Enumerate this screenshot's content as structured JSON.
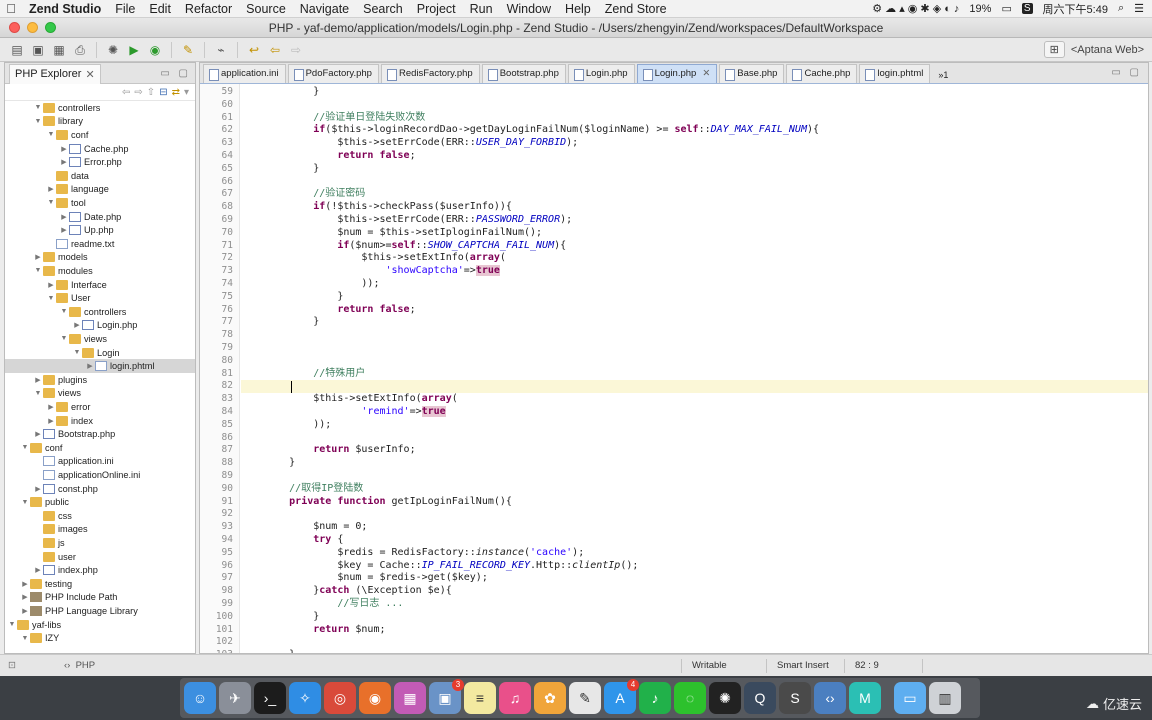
{
  "menubar": {
    "apple": "",
    "app_name": "Zend Studio",
    "items": [
      "File",
      "Edit",
      "Refactor",
      "Source",
      "Navigate",
      "Search",
      "Project",
      "Run",
      "Window",
      "Help",
      "Zend Store"
    ],
    "battery": "19%",
    "clock": "周六下午5:49"
  },
  "window": {
    "title": "PHP - yaf-demo/application/models/Login.php - Zend Studio - /Users/zhengyin/Zend/workspaces/DefaultWorkspace"
  },
  "toolbar": {
    "perspective_label": "<Aptana Web>"
  },
  "explorer": {
    "title": "PHP Explorer",
    "tree": [
      {
        "depth": 3,
        "exp": "open",
        "type": "folder",
        "label": "controllers"
      },
      {
        "depth": 3,
        "exp": "open",
        "type": "folder",
        "label": "library"
      },
      {
        "depth": 4,
        "exp": "open",
        "type": "folder",
        "label": "conf"
      },
      {
        "depth": 5,
        "exp": "closed",
        "type": "php",
        "label": "Cache.php"
      },
      {
        "depth": 5,
        "exp": "closed",
        "type": "php",
        "label": "Error.php"
      },
      {
        "depth": 4,
        "exp": "none",
        "type": "folder",
        "label": "data"
      },
      {
        "depth": 4,
        "exp": "closed",
        "type": "folder",
        "label": "language"
      },
      {
        "depth": 4,
        "exp": "open",
        "type": "folder",
        "label": "tool"
      },
      {
        "depth": 5,
        "exp": "closed",
        "type": "php",
        "label": "Date.php"
      },
      {
        "depth": 5,
        "exp": "closed",
        "type": "php",
        "label": "Up.php"
      },
      {
        "depth": 4,
        "exp": "none",
        "type": "file",
        "label": "readme.txt"
      },
      {
        "depth": 3,
        "exp": "closed",
        "type": "folder",
        "label": "models"
      },
      {
        "depth": 3,
        "exp": "open",
        "type": "folder",
        "label": "modules"
      },
      {
        "depth": 4,
        "exp": "closed",
        "type": "folder",
        "label": "Interface"
      },
      {
        "depth": 4,
        "exp": "open",
        "type": "folder",
        "label": "User"
      },
      {
        "depth": 5,
        "exp": "open",
        "type": "folder",
        "label": "controllers"
      },
      {
        "depth": 6,
        "exp": "closed",
        "type": "php",
        "label": "Login.php"
      },
      {
        "depth": 5,
        "exp": "open",
        "type": "folder",
        "label": "views"
      },
      {
        "depth": 6,
        "exp": "open",
        "type": "folder",
        "label": "Login"
      },
      {
        "depth": 7,
        "exp": "closed",
        "type": "file",
        "label": "login.phtml",
        "selected": true
      },
      {
        "depth": 3,
        "exp": "closed",
        "type": "folder",
        "label": "plugins"
      },
      {
        "depth": 3,
        "exp": "open",
        "type": "folder",
        "label": "views"
      },
      {
        "depth": 4,
        "exp": "closed",
        "type": "folder",
        "label": "error"
      },
      {
        "depth": 4,
        "exp": "closed",
        "type": "folder",
        "label": "index"
      },
      {
        "depth": 3,
        "exp": "closed",
        "type": "php",
        "label": "Bootstrap.php"
      },
      {
        "depth": 2,
        "exp": "open",
        "type": "folder",
        "label": "conf"
      },
      {
        "depth": 3,
        "exp": "none",
        "type": "file",
        "label": "application.ini"
      },
      {
        "depth": 3,
        "exp": "none",
        "type": "file",
        "label": "applicationOnline.ini"
      },
      {
        "depth": 3,
        "exp": "closed",
        "type": "php",
        "label": "const.php"
      },
      {
        "depth": 2,
        "exp": "open",
        "type": "folder",
        "label": "public"
      },
      {
        "depth": 3,
        "exp": "none",
        "type": "folder",
        "label": "css"
      },
      {
        "depth": 3,
        "exp": "none",
        "type": "folder",
        "label": "images"
      },
      {
        "depth": 3,
        "exp": "none",
        "type": "folder",
        "label": "js"
      },
      {
        "depth": 3,
        "exp": "none",
        "type": "folder",
        "label": "user"
      },
      {
        "depth": 3,
        "exp": "closed",
        "type": "php",
        "label": "index.php"
      },
      {
        "depth": 2,
        "exp": "closed",
        "type": "folder",
        "label": "testing"
      },
      {
        "depth": 2,
        "exp": "closed",
        "type": "lib",
        "label": "PHP Include Path"
      },
      {
        "depth": 2,
        "exp": "closed",
        "type": "lib",
        "label": "PHP Language Library"
      },
      {
        "depth": 1,
        "exp": "open",
        "type": "folder",
        "label": "yaf-libs"
      },
      {
        "depth": 2,
        "exp": "open",
        "type": "folder",
        "label": "IZY"
      }
    ]
  },
  "editor": {
    "tabs": [
      {
        "label": "application.ini",
        "active": false
      },
      {
        "label": "PdoFactory.php",
        "active": false
      },
      {
        "label": "RedisFactory.php",
        "active": false
      },
      {
        "label": "Bootstrap.php",
        "active": false
      },
      {
        "label": "Login.php",
        "active": false
      },
      {
        "label": "Login.php",
        "active": true
      },
      {
        "label": "Base.php",
        "active": false
      },
      {
        "label": "Cache.php",
        "active": false
      },
      {
        "label": "login.phtml",
        "active": false
      }
    ],
    "overflow_count": "1",
    "current_line": 82,
    "lines": [
      {
        "n": "59",
        "segs": [
          [
            "",
            "            }"
          ]
        ]
      },
      {
        "n": "60",
        "segs": [
          [
            "",
            ""
          ]
        ]
      },
      {
        "n": "61",
        "segs": [
          [
            "cm",
            "            //验证单日登陆失败次数"
          ]
        ]
      },
      {
        "n": "62",
        "segs": [
          [
            "kw",
            "            if"
          ],
          [
            "",
            "($this->loginRecordDao->getDayLoginFailNum($loginName) >= "
          ],
          [
            "kw",
            "self"
          ],
          [
            "",
            "::"
          ],
          [
            "cst",
            "DAY_MAX_FAIL_NUM"
          ],
          [
            "",
            "){"
          ]
        ]
      },
      {
        "n": "63",
        "segs": [
          [
            "",
            "                $this->setErrCode(ERR::"
          ],
          [
            "cst",
            "USER_DAY_FORBID"
          ],
          [
            "",
            ");"
          ]
        ]
      },
      {
        "n": "64",
        "segs": [
          [
            "kw",
            "                return false"
          ],
          [
            "",
            ";"
          ]
        ]
      },
      {
        "n": "65",
        "segs": [
          [
            "",
            "            }"
          ]
        ]
      },
      {
        "n": "66",
        "segs": [
          [
            "",
            ""
          ]
        ]
      },
      {
        "n": "67",
        "segs": [
          [
            "cm",
            "            //验证密码"
          ]
        ]
      },
      {
        "n": "68",
        "segs": [
          [
            "kw",
            "            if"
          ],
          [
            "",
            "(!$this->checkPass($userInfo)){"
          ]
        ]
      },
      {
        "n": "69",
        "segs": [
          [
            "",
            "                $this->setErrCode(ERR::"
          ],
          [
            "cst",
            "PASSWORD_ERROR"
          ],
          [
            "",
            ");"
          ]
        ]
      },
      {
        "n": "70",
        "segs": [
          [
            "",
            "                $num = $this->setIploginFailNum();"
          ]
        ]
      },
      {
        "n": "71",
        "segs": [
          [
            "kw",
            "                if"
          ],
          [
            "",
            "($num>="
          ],
          [
            "kw",
            "self"
          ],
          [
            "",
            "::"
          ],
          [
            "cst",
            "SHOW_CAPTCHA_FAIL_NUM"
          ],
          [
            "",
            "){"
          ]
        ]
      },
      {
        "n": "72",
        "segs": [
          [
            "",
            "                    $this->setExtInfo("
          ],
          [
            "kw",
            "array"
          ],
          [
            "",
            "("
          ]
        ]
      },
      {
        "n": "73",
        "segs": [
          [
            "st",
            "                        'showCaptcha'"
          ],
          [
            "",
            "=>"
          ],
          [
            "tr",
            "true"
          ]
        ]
      },
      {
        "n": "74",
        "segs": [
          [
            "",
            "                    ));"
          ]
        ]
      },
      {
        "n": "75",
        "segs": [
          [
            "",
            "                }"
          ]
        ]
      },
      {
        "n": "76",
        "segs": [
          [
            "kw",
            "                return false"
          ],
          [
            "",
            ";"
          ]
        ]
      },
      {
        "n": "77",
        "segs": [
          [
            "",
            "            }"
          ]
        ]
      },
      {
        "n": "78",
        "segs": [
          [
            "",
            ""
          ]
        ]
      },
      {
        "n": "79",
        "segs": [
          [
            "",
            ""
          ]
        ]
      },
      {
        "n": "80",
        "segs": [
          [
            "",
            ""
          ]
        ]
      },
      {
        "n": "81",
        "segs": [
          [
            "cm",
            "            //特殊用户"
          ]
        ]
      },
      {
        "n": "82",
        "segs": [
          [
            "",
            ""
          ]
        ]
      },
      {
        "n": "83",
        "segs": [
          [
            "",
            "            $this->setExtInfo("
          ],
          [
            "kw",
            "array"
          ],
          [
            "",
            "("
          ]
        ]
      },
      {
        "n": "84",
        "segs": [
          [
            "st",
            "                    'remind'"
          ],
          [
            "",
            "=>"
          ],
          [
            "tr",
            "true"
          ]
        ]
      },
      {
        "n": "85",
        "segs": [
          [
            "",
            "            ));"
          ]
        ]
      },
      {
        "n": "86",
        "segs": [
          [
            "",
            ""
          ]
        ]
      },
      {
        "n": "87",
        "segs": [
          [
            "kw",
            "            return"
          ],
          [
            "",
            " $userInfo;"
          ]
        ]
      },
      {
        "n": "88",
        "segs": [
          [
            "",
            "        }"
          ]
        ]
      },
      {
        "n": "89",
        "segs": [
          [
            "",
            ""
          ]
        ]
      },
      {
        "n": "90",
        "segs": [
          [
            "cm",
            "        //取得IP登陆数"
          ]
        ]
      },
      {
        "n": "91",
        "segs": [
          [
            "kw",
            "        private function"
          ],
          [
            "",
            " getIpLoginFailNum(){"
          ]
        ]
      },
      {
        "n": "92",
        "segs": [
          [
            "",
            ""
          ]
        ]
      },
      {
        "n": "93",
        "segs": [
          [
            "",
            "            $num = 0;"
          ]
        ]
      },
      {
        "n": "94",
        "segs": [
          [
            "kw",
            "            try"
          ],
          [
            "",
            " {"
          ]
        ]
      },
      {
        "n": "95",
        "segs": [
          [
            "",
            "                $redis = RedisFactory::"
          ],
          [
            "it",
            "instance"
          ],
          [
            "",
            "("
          ],
          [
            "st",
            "'cache'"
          ],
          [
            "",
            ");"
          ]
        ]
      },
      {
        "n": "96",
        "segs": [
          [
            "",
            "                $key = Cache::"
          ],
          [
            "cst",
            "IP_FAIL_RECORD_KEY"
          ],
          [
            "",
            ".Http::"
          ],
          [
            "it",
            "clientIp"
          ],
          [
            "",
            "();"
          ]
        ]
      },
      {
        "n": "97",
        "segs": [
          [
            "",
            "                $num = $redis->get($key);"
          ]
        ]
      },
      {
        "n": "98",
        "segs": [
          [
            "",
            "            }"
          ],
          [
            "kw",
            "catch"
          ],
          [
            "",
            " (\\Exception $e){"
          ]
        ]
      },
      {
        "n": "99",
        "segs": [
          [
            "cm",
            "                //写日志 ..."
          ]
        ]
      },
      {
        "n": "100",
        "segs": [
          [
            "",
            "            }"
          ]
        ]
      },
      {
        "n": "101",
        "segs": [
          [
            "kw",
            "            return"
          ],
          [
            "",
            " $num;"
          ]
        ]
      },
      {
        "n": "102",
        "segs": [
          [
            "",
            ""
          ]
        ]
      },
      {
        "n": "103",
        "segs": [
          [
            "",
            "        }"
          ]
        ]
      }
    ]
  },
  "statusbar": {
    "language": "PHP",
    "writable": "Writable",
    "insert_mode": "Smart Insert",
    "position": "82 : 9"
  },
  "dock": {
    "icons": [
      "finder-icon",
      "launchpad-icon",
      "terminal-icon",
      "safari-icon",
      "chrome-icon",
      "firefox-icon",
      "app-grid-icon",
      "preview-icon",
      "notes-icon",
      "itunes-icon",
      "photos-icon",
      "textedit-icon",
      "app-store-icon",
      "qq-music-icon",
      "wechat-icon",
      "qq-icon",
      "quicktime-icon",
      "sublime-icon",
      "zend-studio-icon",
      "mindmaster-icon",
      "folder-icon",
      "trash-icon"
    ],
    "badges": {
      "preview-icon": "3",
      "app-store-icon": "4"
    },
    "watermark": "亿速云"
  }
}
